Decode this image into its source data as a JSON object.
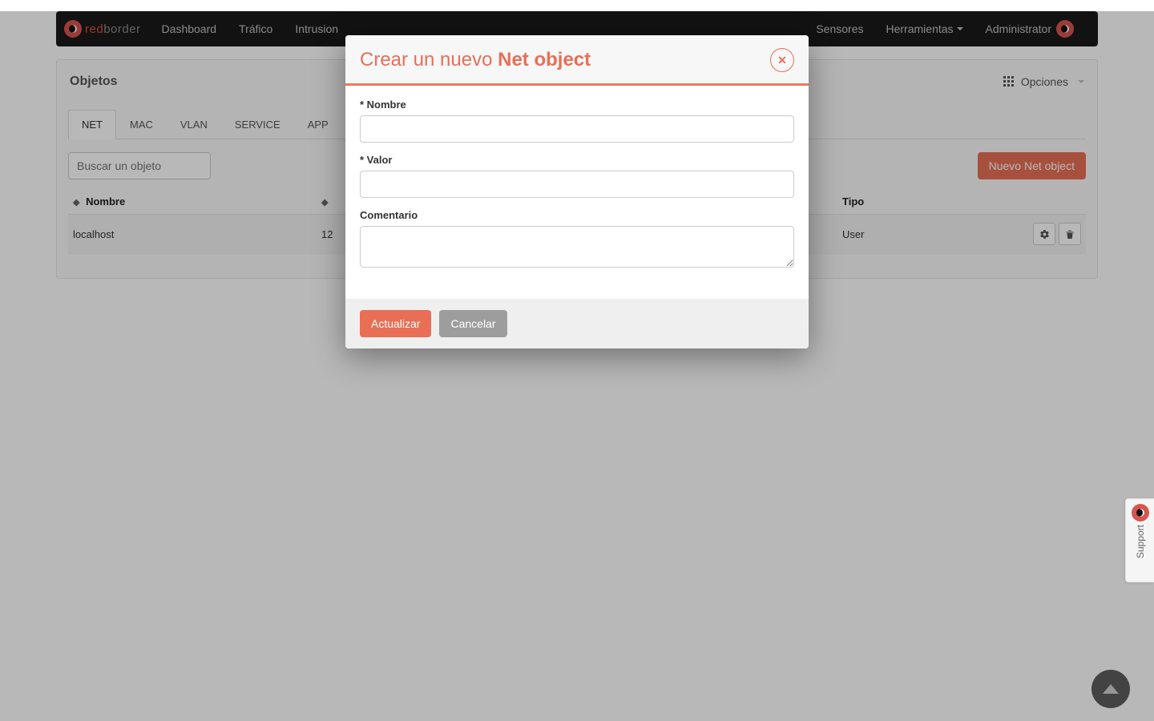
{
  "brand": {
    "prefix": "red",
    "suffix": "border"
  },
  "nav": {
    "left": [
      "Dashboard",
      "Tráfico",
      "Intrusion"
    ],
    "right": [
      "Sensores",
      "Herramientas",
      "Administrator"
    ]
  },
  "panel": {
    "title": "Objetos",
    "options_label": "Opciones"
  },
  "tabs": [
    "NET",
    "MAC",
    "VLAN",
    "SERVICE",
    "APP"
  ],
  "search": {
    "placeholder": "Buscar un objeto"
  },
  "buttons": {
    "new_object": "Nuevo Net object"
  },
  "table": {
    "headers": {
      "name": "Nombre",
      "type": "Tipo"
    },
    "rows": [
      {
        "name": "localhost",
        "value_prefix": "12",
        "type": "User"
      }
    ]
  },
  "modal": {
    "title_prefix": "Crear un nuevo ",
    "title_bold": "Net object",
    "labels": {
      "name": "* Nombre",
      "value": "* Valor",
      "comment": "Comentario"
    },
    "submit": "Actualizar",
    "cancel": "Cancelar"
  },
  "support": {
    "label": "Support"
  }
}
